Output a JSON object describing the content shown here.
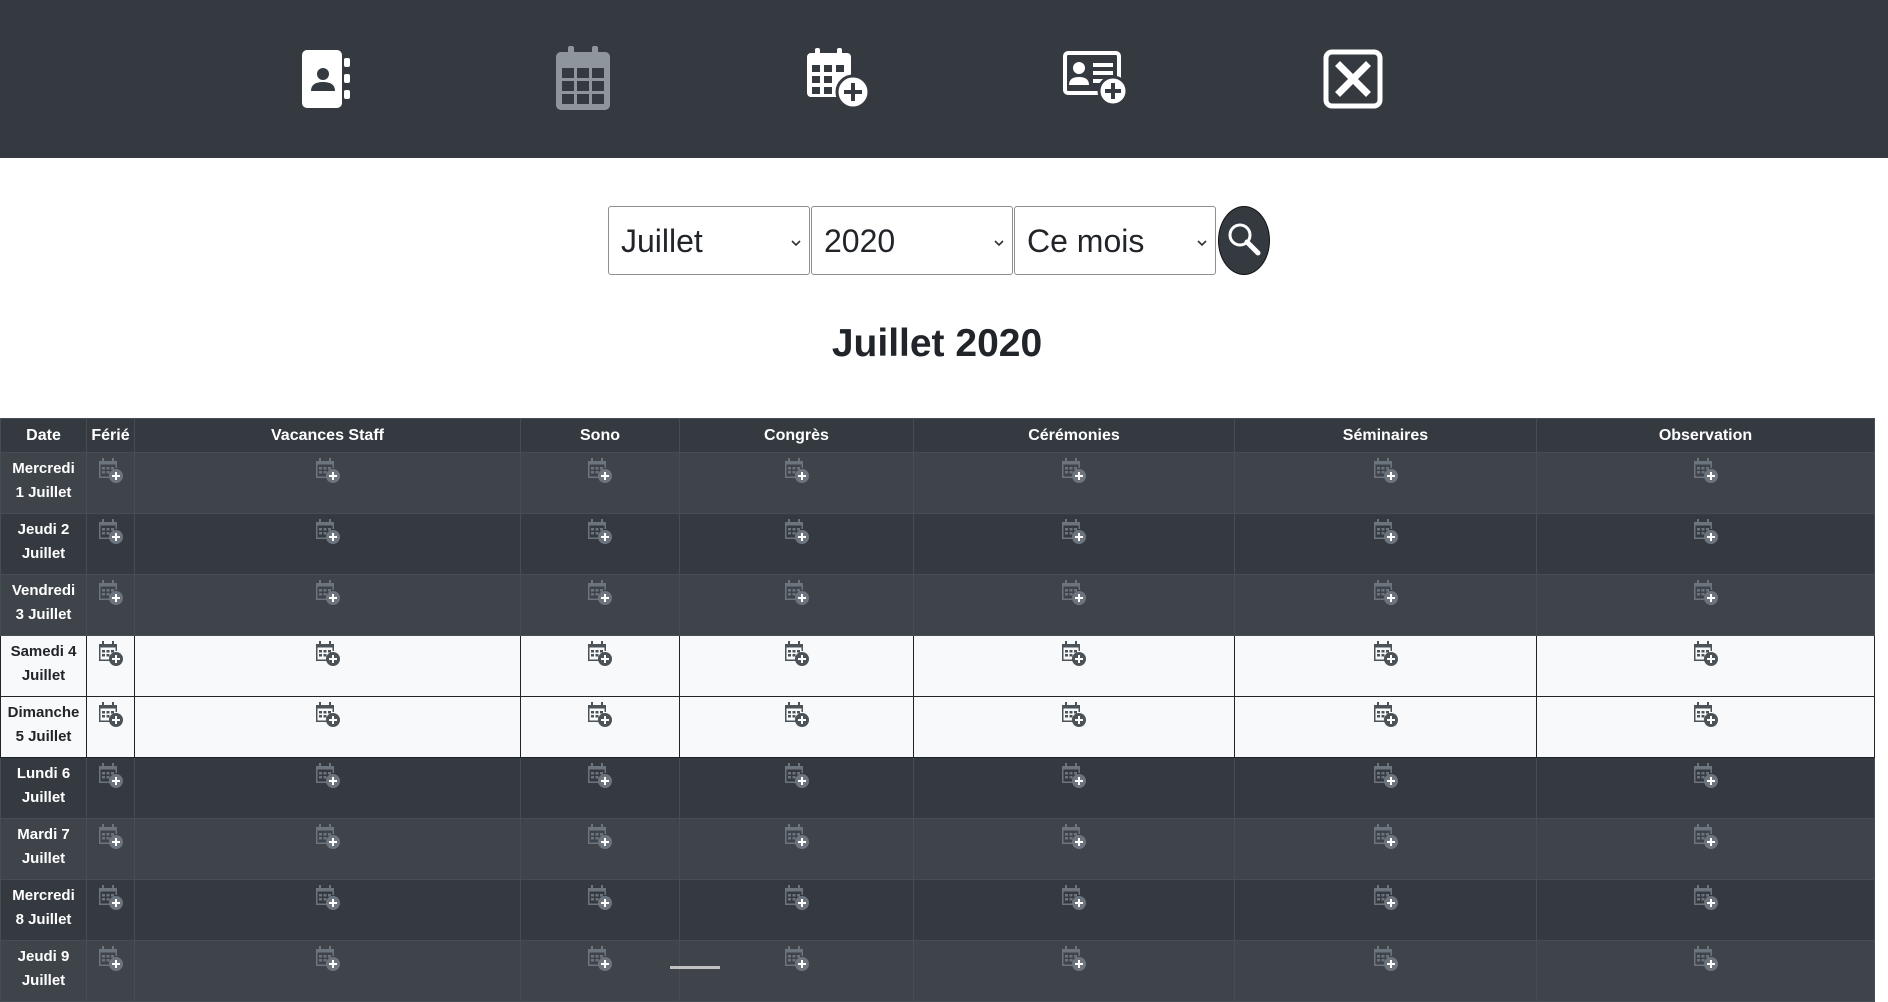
{
  "nav": [
    {
      "name": "address-book-icon"
    },
    {
      "name": "calendar-icon"
    },
    {
      "name": "calendar-add-icon"
    },
    {
      "name": "contact-card-add-icon"
    },
    {
      "name": "close-box-icon"
    }
  ],
  "filters": {
    "month": {
      "value": "Juillet",
      "options": [
        "Juillet"
      ]
    },
    "year": {
      "value": "2020",
      "options": [
        "2020"
      ]
    },
    "range": {
      "value": "Ce mois",
      "options": [
        "Ce mois"
      ]
    }
  },
  "title": "Juillet 2020",
  "table": {
    "headers": [
      "Date",
      "Férié",
      "Vacances Staff",
      "Sono",
      "Congrès",
      "Cérémonies",
      "Séminaires",
      "Observation"
    ],
    "rows": [
      {
        "date_line1": "Mercredi",
        "date_line2": "1 Juillet",
        "style": "dark-odd"
      },
      {
        "date_line1": "Jeudi 2",
        "date_line2": "Juillet",
        "style": "dark-even"
      },
      {
        "date_line1": "Vendredi",
        "date_line2": "3 Juillet",
        "style": "dark-odd"
      },
      {
        "date_line1": "Samedi 4",
        "date_line2": "Juillet",
        "style": "light"
      },
      {
        "date_line1": "Dimanche",
        "date_line2": "5 Juillet",
        "style": "light"
      },
      {
        "date_line1": "Lundi 6",
        "date_line2": "Juillet",
        "style": "dark-even"
      },
      {
        "date_line1": "Mardi 7",
        "date_line2": "Juillet",
        "style": "dark-odd"
      },
      {
        "date_line1": "Mercredi",
        "date_line2": "8 Juillet",
        "style": "dark-even"
      },
      {
        "date_line1": "Jeudi 9",
        "date_line2": "Juillet",
        "style": "dark-odd"
      }
    ],
    "cell_icon": "calendar-add-icon"
  },
  "colors": {
    "nav_bg": "#343a40",
    "row_dark_a": "#3e444a",
    "row_dark_b": "#343a40",
    "row_light": "#f8f9fa"
  }
}
